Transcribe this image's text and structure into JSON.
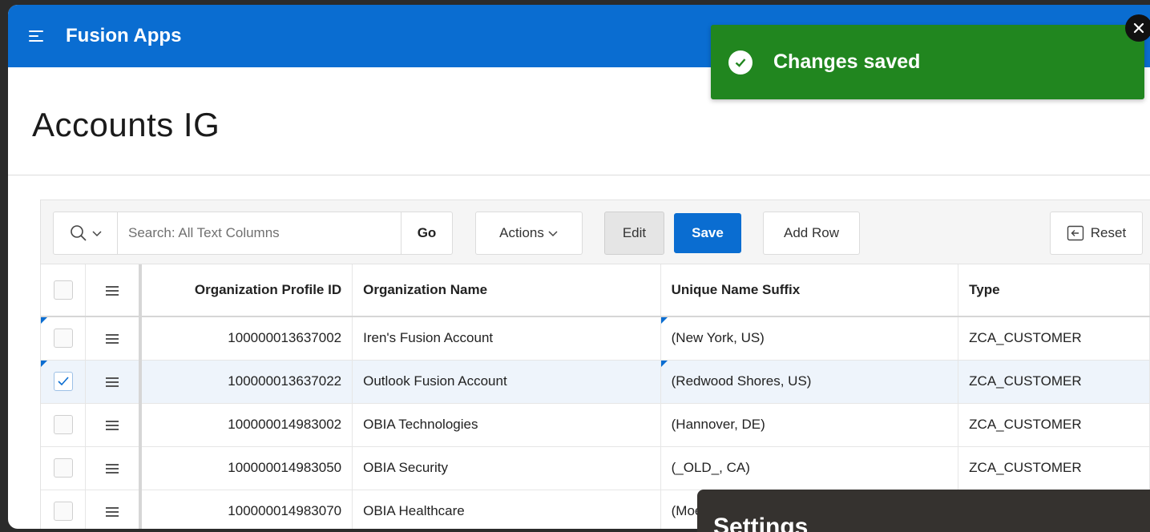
{
  "app": {
    "title": "Fusion Apps"
  },
  "page": {
    "title": "Accounts IG"
  },
  "toast": {
    "message": "Changes saved",
    "color": "#21861f"
  },
  "toolbar": {
    "search_placeholder": "Search: All Text Columns",
    "go_label": "Go",
    "actions_label": "Actions",
    "edit_label": "Edit",
    "save_label": "Save",
    "add_row_label": "Add Row",
    "reset_label": "Reset"
  },
  "grid": {
    "columns": [
      "Organization Profile ID",
      "Organization Name",
      "Unique Name Suffix",
      "Type"
    ],
    "rows": [
      {
        "id": "100000013637002",
        "name": "Iren's Fusion Account",
        "suffix": "(New York, US)",
        "type": "ZCA_CUSTOMER",
        "checked": false
      },
      {
        "id": "100000013637022",
        "name": "Outlook Fusion Account",
        "suffix": "(Redwood Shores, US)",
        "type": "ZCA_CUSTOMER",
        "checked": true
      },
      {
        "id": "100000014983002",
        "name": "OBIA Technologies",
        "suffix": "(Hannover, DE)",
        "type": "ZCA_CUSTOMER",
        "checked": false
      },
      {
        "id": "100000014983050",
        "name": "OBIA Security",
        "suffix": "(_OLD_, CA)",
        "type": "ZCA_CUSTOMER",
        "checked": false
      },
      {
        "id": "100000014983070",
        "name": "OBIA Healthcare",
        "suffix": "(Moe",
        "type": "",
        "checked": false
      }
    ]
  },
  "settings_panel": {
    "title": "Settings"
  },
  "colors": {
    "header": "#0a6dd1",
    "primary_button": "#0a6dd1",
    "success": "#21861f"
  }
}
